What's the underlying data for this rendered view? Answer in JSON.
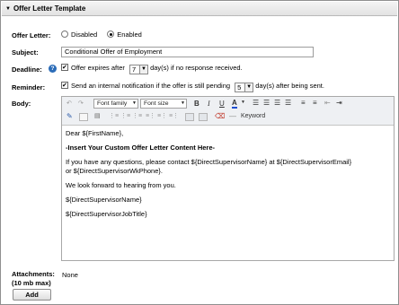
{
  "section": {
    "title": "Offer Letter Template"
  },
  "offer_letter": {
    "label": "Offer Letter:",
    "options": [
      {
        "label": "Disabled",
        "selected": false
      },
      {
        "label": "Enabled",
        "selected": true
      }
    ]
  },
  "subject": {
    "label": "Subject:",
    "value": "Conditional Offer of Employment"
  },
  "deadline": {
    "label": "Deadline:",
    "help_icon": "?",
    "checkbox_text": "Offer expires after",
    "days_value": "7",
    "suffix": "day(s) if no response received."
  },
  "reminder": {
    "label": "Reminder:",
    "checkbox_text": "Send an internal notification if the offer is still pending",
    "days_value": "5",
    "suffix": "day(s) after being sent."
  },
  "body": {
    "label": "Body:",
    "toolbar": {
      "font_family": "Font family",
      "font_size": "Font size",
      "bold": "B",
      "italic": "I",
      "underline": "U",
      "font_color": "A",
      "keyword": "Keyword"
    },
    "content": {
      "greeting": "Dear ${FirstName},",
      "insert_line": "-Insert Your Custom Offer Letter Content Here-",
      "questions_line1": "If you have any questions, please contact ${DirectSupervisorName} at ${DirectSupervisorEmail}",
      "questions_line2": "or ${DirectSupervisorWkPhone}.",
      "closing": "We look forward to hearing from you.",
      "signature_name": "${DirectSupervisorName}",
      "signature_title": "${DirectSupervisorJobTitle}"
    }
  },
  "attachments": {
    "label_line1": "Attachments:",
    "label_line2": "(10 mb max)",
    "value": "None",
    "add_button": "Add"
  },
  "colors": {
    "help_icon": "#2b6cb8",
    "font_color_bar": "#1f4fd1"
  }
}
